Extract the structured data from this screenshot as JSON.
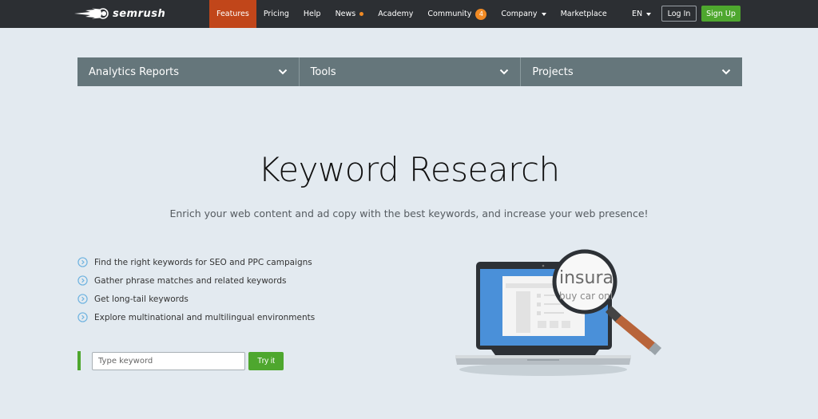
{
  "header": {
    "logo_text": "semrush",
    "nav": [
      {
        "label": "Features",
        "active": true
      },
      {
        "label": "Pricing"
      },
      {
        "label": "Help"
      },
      {
        "label": "News",
        "indicator": "dot"
      },
      {
        "label": "Academy"
      },
      {
        "label": "Community",
        "badge": "4"
      },
      {
        "label": "Company",
        "dropdown": true
      },
      {
        "label": "Marketplace"
      }
    ],
    "language": "EN",
    "login_label": "Log In",
    "signup_label": "Sign Up"
  },
  "menu": [
    {
      "label": "Analytics Reports"
    },
    {
      "label": "Tools"
    },
    {
      "label": "Projects"
    }
  ],
  "hero": {
    "title": "Keyword Research",
    "subtitle": "Enrich your web content and ad copy with the best keywords, and increase your web presence!"
  },
  "features": [
    "Find the right keywords for SEO and PPC campaigns",
    "Gather phrase matches and related keywords",
    "Get long-tail keywords",
    "Explore multinational and multilingual environments"
  ],
  "search": {
    "placeholder": "Type keyword",
    "value": "",
    "button_label": "Try it"
  },
  "illustration": {
    "magnified_text_line1": "insura",
    "magnified_text_line2": "buy car onl"
  },
  "colors": {
    "topbar": "#2c2f33",
    "active_nav": "#c1461a",
    "accent_orange": "#f08a24",
    "green": "#4ea72e",
    "menu_bg": "#65767b",
    "page_bg": "#e3eaf0"
  }
}
